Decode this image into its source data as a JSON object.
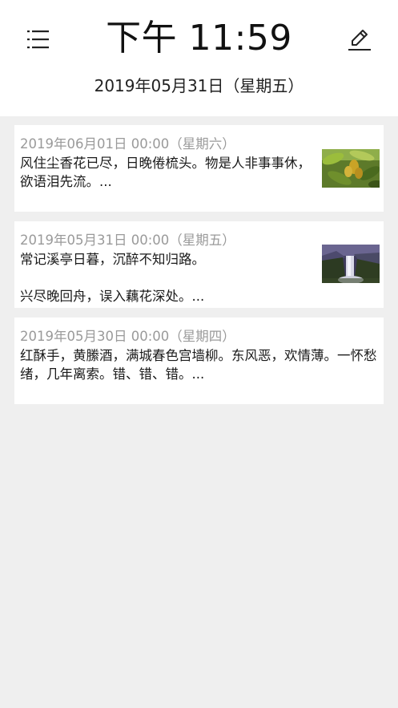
{
  "header": {
    "clock": "下午 11:59",
    "date": "2019年05月31日（星期五）",
    "menu_icon": "menu-icon",
    "edit_icon": "edit-icon"
  },
  "entries": [
    {
      "date": "2019年06月01日 00:00（星期六）",
      "text": "风住尘香花已尽，日晚倦梳头。物是人非事事休，欲语泪先流。...",
      "thumbnail": "green-leaves-with-fruit-photo"
    },
    {
      "date": "2019年05月31日 00:00（星期五）",
      "text": "常记溪亭日暮，沉醉不知归路。\n\n兴尽晚回舟，误入藕花深处。...",
      "thumbnail": "waterfall-landscape-photo"
    },
    {
      "date": "2019年05月30日 00:00（星期四）",
      "text": "红酥手，黄縢酒，满城春色宫墙柳。东风恶，欢情薄。一怀愁绪，几年离索。错、错、错。..."
    }
  ],
  "colors": {
    "background": "#efefef",
    "card": "#ffffff",
    "date_text": "#9a9a9a",
    "body_text": "#1a1a1a"
  }
}
